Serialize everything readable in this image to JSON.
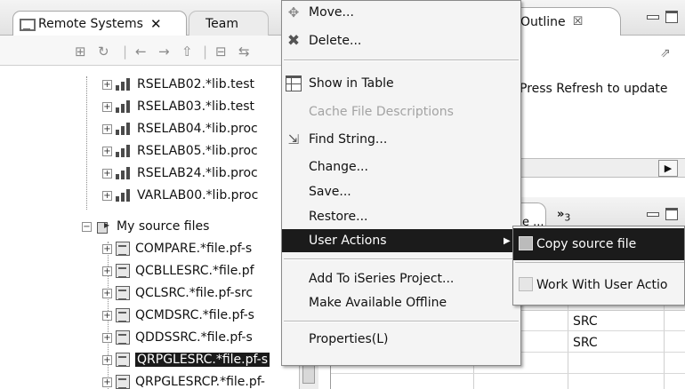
{
  "left_view": {
    "tabs": [
      {
        "label": "Remote Systems",
        "icon": "remote-systems-icon",
        "active": true,
        "close": "✕"
      },
      {
        "label": "Team",
        "active": false
      }
    ],
    "tree": [
      {
        "label": "RSELAB02.*lib.test",
        "kind": "library"
      },
      {
        "label": "RSELAB03.*lib.test",
        "kind": "library"
      },
      {
        "label": "RSELAB04.*lib.proc",
        "kind": "library"
      },
      {
        "label": "RSELAB05.*lib.proc",
        "kind": "library"
      },
      {
        "label": "RSELAB24.*lib.proc",
        "kind": "library"
      },
      {
        "label": "VARLAB00.*lib.proc",
        "kind": "library"
      },
      {
        "label": "My source files",
        "kind": "filter"
      },
      {
        "label": "COMPARE.*file.pf-s",
        "kind": "file"
      },
      {
        "label": "QCBLLESRC.*file.pf",
        "kind": "file"
      },
      {
        "label": "QCLSRC.*file.pf-src",
        "kind": "file"
      },
      {
        "label": "QCMDSRC.*file.pf-s",
        "kind": "file"
      },
      {
        "label": "QDDSSRC.*file.pf-s",
        "kind": "file"
      },
      {
        "label": "QRPGLESRC.*file.pf-s",
        "kind": "file",
        "selected": true
      },
      {
        "label": "QRPGLESRCP.*file.pf-",
        "kind": "file"
      }
    ]
  },
  "outline_view": {
    "tab_label": "Outline",
    "tab_close": "☒",
    "message": "Press Refresh to update",
    "scroll_arrow": "▶"
  },
  "bottom_view": {
    "tab_label": "e ...",
    "overflow_label": "»",
    "overflow_count": "3",
    "cells": [
      "SRC",
      "SRC"
    ]
  },
  "context_menu": {
    "items": [
      {
        "label": "Move...",
        "icon": "move-icon",
        "enabled": true
      },
      {
        "label": "Delete...",
        "icon": "delete-icon",
        "enabled": true
      },
      {
        "label": "Show in Table",
        "icon": "table-icon",
        "enabled": true
      },
      {
        "label": "Cache File Descriptions",
        "enabled": false
      },
      {
        "label": "Find String...",
        "icon": "find-icon",
        "enabled": true
      },
      {
        "label": "Change...",
        "enabled": true
      },
      {
        "label": "Save...",
        "enabled": true
      },
      {
        "label": "Restore...",
        "enabled": true
      },
      {
        "label": "User Actions",
        "enabled": true,
        "highlighted": true,
        "submenu": true,
        "arrow": "▶"
      },
      {
        "label": "Add To iSeries Project...",
        "enabled": true
      },
      {
        "label": "Make Available Offline",
        "enabled": true
      },
      {
        "label": "Properties(L)",
        "enabled": true
      }
    ]
  },
  "user_actions_submenu": {
    "items": [
      {
        "label": "Copy source file",
        "icon": "user-action-icon",
        "highlighted": true
      },
      {
        "label": "Work With User Actio",
        "icon": "work-with-user-actions-icon",
        "highlighted": false
      }
    ]
  },
  "colors": {
    "menu_highlight": "#1b1b1b",
    "menu_background": "#f4f4f4",
    "disabled_text": "#a3a3a3"
  }
}
